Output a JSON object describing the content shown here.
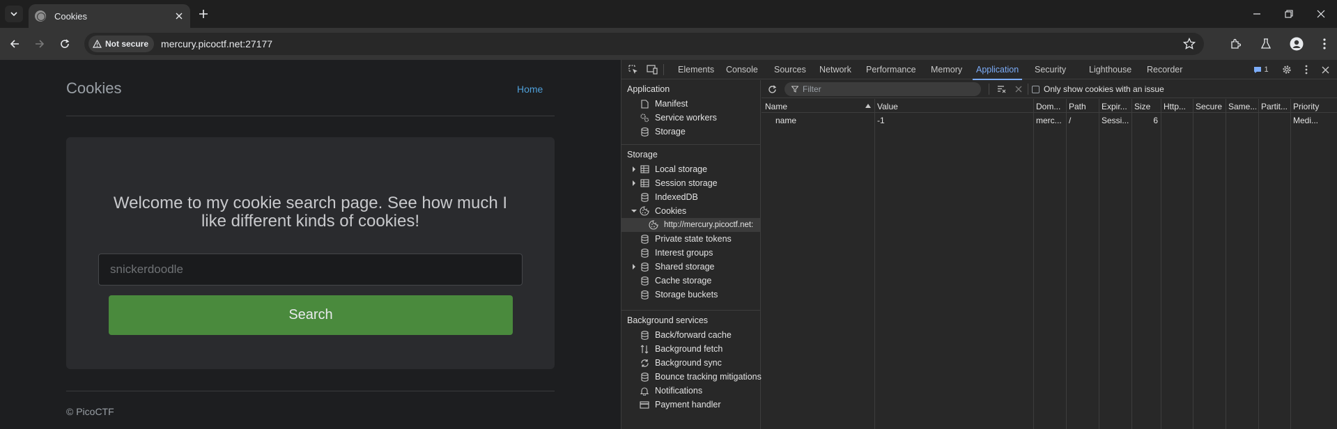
{
  "browser": {
    "tab_title": "Cookies",
    "url": "mercury.picoctf.net:27177",
    "security_chip": "Not secure"
  },
  "page": {
    "site_title": "Cookies",
    "nav_home": "Home",
    "welcome": "Welcome to my cookie search page. See how much I like different kinds of cookies!",
    "search_placeholder": "snickerdoodle",
    "search_button": "Search",
    "footer": "© PicoCTF"
  },
  "devtools": {
    "tabs": [
      "Elements",
      "Console",
      "Sources",
      "Network",
      "Performance",
      "Memory",
      "Application",
      "Security",
      "Lighthouse",
      "Recorder"
    ],
    "active_tab": "Application",
    "issues_count": "1",
    "sidebar": {
      "application_header": "Application",
      "application_items": [
        "Manifest",
        "Service workers",
        "Storage"
      ],
      "storage_header": "Storage",
      "storage_items": [
        "Local storage",
        "Session storage",
        "IndexedDB",
        "Cookies",
        "http://mercury.picoctf.net:",
        "Private state tokens",
        "Interest groups",
        "Shared storage",
        "Cache storage",
        "Storage buckets"
      ],
      "background_header": "Background services",
      "background_items": [
        "Back/forward cache",
        "Background fetch",
        "Background sync",
        "Bounce tracking mitigations",
        "Notifications",
        "Payment handler"
      ]
    },
    "cookies": {
      "filter_placeholder": "Filter",
      "only_issue_label": "Only show cookies with an issue",
      "columns": [
        "Name",
        "Value",
        "Dom...",
        "Path",
        "Expir...",
        "Size",
        "Http...",
        "Secure",
        "Same...",
        "Partit...",
        "Priority"
      ],
      "rows": [
        [
          "name",
          "-1",
          "merc...",
          "/",
          "Sessi...",
          "6",
          "",
          "",
          "",
          "",
          "Medi..."
        ]
      ]
    }
  }
}
